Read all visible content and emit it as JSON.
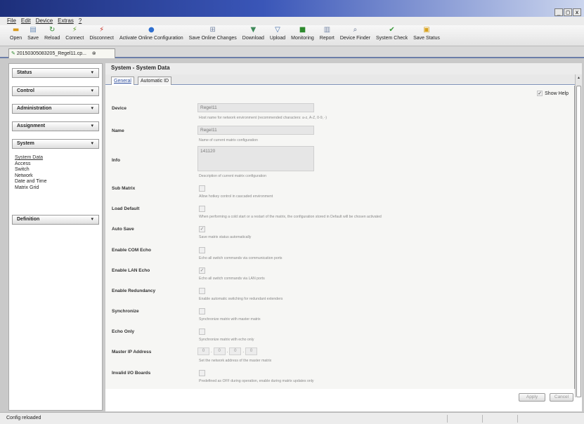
{
  "window": {
    "controls": [
      "_",
      "□",
      "x"
    ]
  },
  "menu": [
    "File",
    "Edit",
    "Device",
    "Extras",
    "?"
  ],
  "toolbar": [
    {
      "label": "Open",
      "icon": "folder-icon",
      "glyph": "▬",
      "color": "#d89a1c"
    },
    {
      "label": "Save",
      "icon": "save-icon",
      "glyph": "▤",
      "color": "#6b8db8"
    },
    {
      "label": "Reload",
      "icon": "reload-icon",
      "glyph": "↻",
      "color": "#2e8a2e"
    },
    {
      "label": "Connect",
      "icon": "connect-icon",
      "glyph": "⚡",
      "color": "#5fa02a"
    },
    {
      "label": "Disconnect",
      "icon": "disconnect-icon",
      "glyph": "⚡",
      "color": "#c83228"
    },
    {
      "label": "Activate Online Configuration",
      "icon": "activate-icon",
      "glyph": "●",
      "color": "#2f6fcf"
    },
    {
      "label": "Save Online Changes",
      "icon": "save-changes-icon",
      "glyph": "⊞",
      "color": "#7a8aa8"
    },
    {
      "label": "Download",
      "icon": "download-icon",
      "glyph": "▼",
      "color": "#3f8a5a"
    },
    {
      "label": "Upload",
      "icon": "upload-icon",
      "glyph": "▽",
      "color": "#3f6aa8"
    },
    {
      "label": "Monitoring",
      "icon": "monitoring-icon",
      "glyph": "■",
      "color": "#2e8a2e"
    },
    {
      "label": "Report",
      "icon": "report-icon",
      "glyph": "▥",
      "color": "#7a8aa8"
    },
    {
      "label": "Device Finder",
      "icon": "device-finder-icon",
      "glyph": "⌕",
      "color": "#5a6a88"
    },
    {
      "label": "System Check",
      "icon": "system-check-icon",
      "glyph": "✔",
      "color": "#3a9a3a"
    },
    {
      "label": "Save Status",
      "icon": "save-status-icon",
      "glyph": "▣",
      "color": "#d8a21c"
    }
  ],
  "document_tab": {
    "label": "20150305083205_Regel11.cp...",
    "close": "⊗"
  },
  "sidebar": {
    "sections": [
      "Status",
      "Control",
      "Administration",
      "Assignment",
      "System",
      "Definition"
    ],
    "chevron": "▾",
    "system_items": [
      "System Data",
      "Access",
      "Switch",
      "Network",
      "Date and Time",
      "Matrix Grid"
    ]
  },
  "content": {
    "title": "System - System Data",
    "tabs": [
      "General",
      "Automatic ID"
    ],
    "show_help": "Show Help",
    "fields": {
      "device": {
        "label": "Device",
        "value": "Regel11",
        "help": "Host name for network environment (recommended characters: a-z, A-Z, 0-9, -)"
      },
      "name": {
        "label": "Name",
        "value": "Regel11",
        "help": "Name of current matrix configuration"
      },
      "info": {
        "label": "Info",
        "value": "141120",
        "help": "Description of current matrix configuration"
      },
      "sub_matrix": {
        "label": "Sub Matrix",
        "checked": false,
        "help": "Allow hotkey control in cascaded environment"
      },
      "load_default": {
        "label": "Load Default",
        "checked": false,
        "help": "When performing a cold start or a restart of the matrix, the configuration stored in Default will be chosen activated"
      },
      "auto_save": {
        "label": "Auto Save",
        "checked": true,
        "help": "Save matrix status automatically"
      },
      "enable_com_echo": {
        "label": "Enable COM Echo",
        "checked": false,
        "help": "Echo all switch commands via communication ports"
      },
      "enable_lan_echo": {
        "label": "Enable LAN Echo",
        "checked": true,
        "help": "Echo all switch commands via LAN ports"
      },
      "enable_redundancy": {
        "label": "Enable Redundancy",
        "checked": false,
        "help": "Enable automatic switching for redundant extenders"
      },
      "synchronize": {
        "label": "Synchronize",
        "checked": false,
        "help": "Synchronize matrix with master matrix"
      },
      "echo_only": {
        "label": "Echo Only",
        "checked": false,
        "help": "Synchronize matrix with echo only"
      },
      "master_ip": {
        "label": "Master IP Address",
        "octets": [
          "0",
          "0",
          "0",
          "0"
        ],
        "help": "Set the network address of the master matrix"
      },
      "invalid_io": {
        "label": "Invalid I/O Boards",
        "checked": false,
        "help": "Predefined as OFF during operation, enable during matrix updates only"
      }
    },
    "apply": "Apply",
    "cancel": "Cancel"
  },
  "status": "Config reloaded"
}
